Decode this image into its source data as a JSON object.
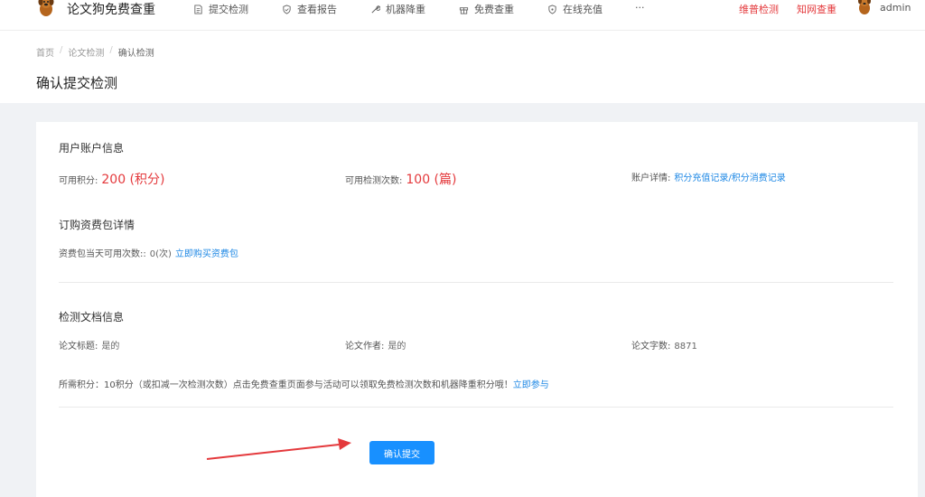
{
  "nav": {
    "brand": "论文狗免费查重",
    "items": [
      {
        "label": "提交检测",
        "icon": "document-icon"
      },
      {
        "label": "查看报告",
        "icon": "shield-icon"
      },
      {
        "label": "机器降重",
        "icon": "wrench-icon"
      },
      {
        "label": "免费查重",
        "icon": "gift-icon"
      },
      {
        "label": "在线充值",
        "icon": "shield-check-icon"
      },
      {
        "label": "···",
        "icon": ""
      }
    ],
    "red_links": [
      "维普检测",
      "知网查重"
    ],
    "user": "admin"
  },
  "breadcrumb": [
    "首页",
    "论文检测",
    "确认检测"
  ],
  "page_title": "确认提交检测",
  "account": {
    "title": "用户账户信息",
    "points_label": "可用积分:",
    "points_value": "200 (积分)",
    "checks_label": "可用检测次数:",
    "checks_value": "100 (篇)",
    "detail_label": "账户详情:",
    "detail_link": "积分充值记录/积分消费记录"
  },
  "package": {
    "title": "订购资费包详情",
    "daily_label": "资费包当天可用次数::",
    "daily_value": "0(次)",
    "buy_link": "立即购买资费包"
  },
  "doc": {
    "title": "检测文档信息",
    "paper_title_label": "论文标题:",
    "paper_title_value": "是的",
    "author_label": "论文作者:",
    "author_value": "是的",
    "words_label": "论文字数:",
    "words_value": "8871",
    "required_text": "所需积分：10积分（或扣减一次检测次数）点击免费查重页面参与活动可以领取免费检测次数和机器降重积分哦！",
    "join_link": "立即参与"
  },
  "confirm_button": "确认提交",
  "colors": {
    "accent": "#1890ff",
    "red": "#e4393c",
    "link": "#1e88e5"
  }
}
